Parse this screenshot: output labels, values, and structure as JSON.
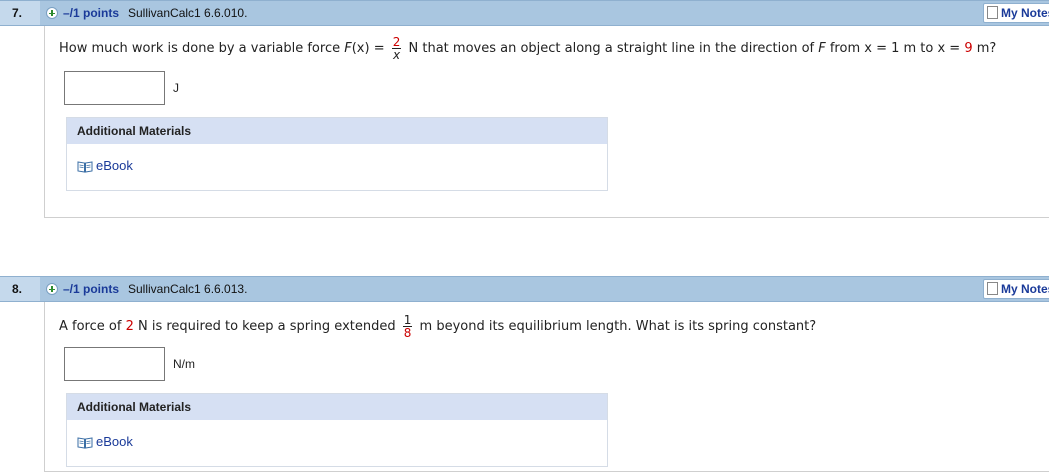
{
  "questions": [
    {
      "number": "7.",
      "points": "–/1 points",
      "code": "SullivanCalc1 6.6.010.",
      "my_notes": "My Notes",
      "text": {
        "p1": "How much work is done by a variable force",
        "fx": "F",
        "fx_rest": "(x) =",
        "frac_num": "2",
        "frac_den": "x",
        "p2": "N  that moves an object along a straight line in the direction of",
        "F": "F",
        "p3": "from  x = 1 m  to  x =",
        "value": "9",
        "p4": "m?"
      },
      "unit": "J",
      "additional_materials": "Additional Materials",
      "ebook": "eBook"
    },
    {
      "number": "8.",
      "points": "–/1 points",
      "code": "SullivanCalc1 6.6.013.",
      "my_notes": "My Notes",
      "text": {
        "p1": "A force of",
        "value": "2",
        "p2": "N is required to keep a spring extended",
        "frac_num": "1",
        "frac_den": "8",
        "p3": "m beyond its equilibrium length. What is its spring constant?"
      },
      "unit": "N/m",
      "additional_materials": "Additional Materials",
      "ebook": "eBook"
    }
  ],
  "colors": {
    "header_bg": "#a9c6e0",
    "link_blue": "#1a3a99",
    "highlight_red": "#cc0000",
    "materials_header": "#d6e0f3"
  }
}
